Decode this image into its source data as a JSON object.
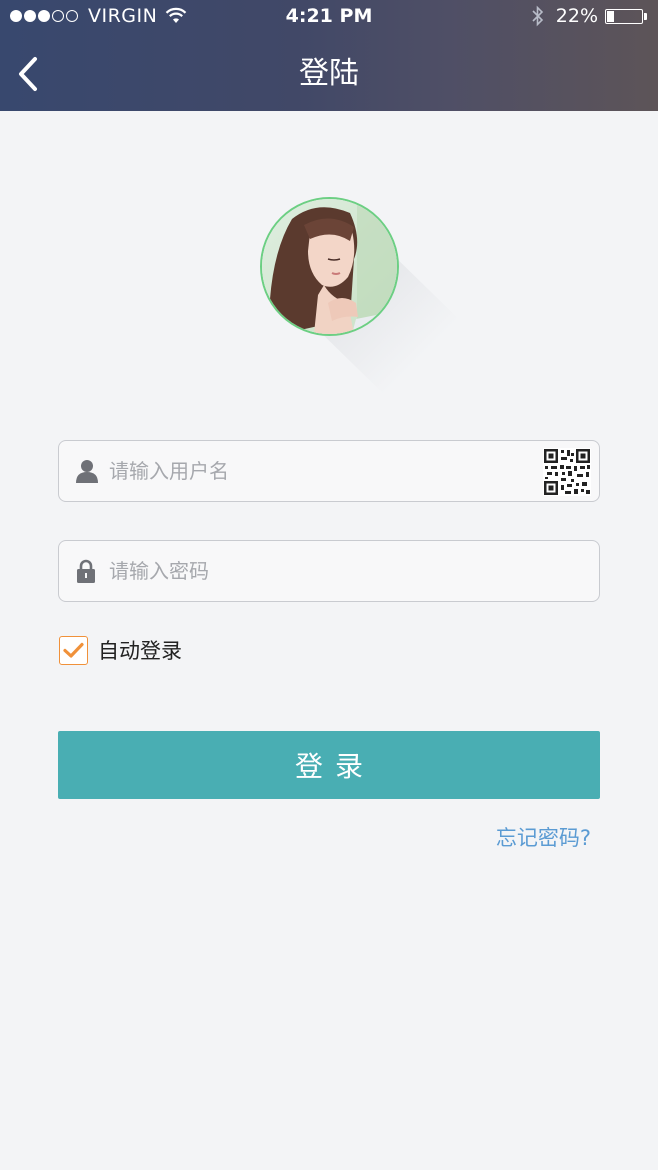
{
  "status_bar": {
    "carrier": "VIRGIN",
    "time": "4:21 PM",
    "battery_percent": "22%",
    "battery_level": 0.22,
    "signal_bars_filled": 3,
    "signal_bars_total": 5
  },
  "nav": {
    "title": "登陆",
    "back_icon": "chevron-left-icon"
  },
  "avatar": {
    "ring_color": "#6ccf83"
  },
  "username_field": {
    "placeholder": "请输入用户名",
    "value": "",
    "icon": "user-icon",
    "trailing_icon": "qr-code-icon"
  },
  "password_field": {
    "placeholder": "请输入密码",
    "value": "",
    "icon": "lock-icon"
  },
  "auto_login": {
    "label": "自动登录",
    "checked": true,
    "check_color": "#f0913a"
  },
  "login_button": {
    "label": "登录",
    "color": "#49aeb3"
  },
  "forgot_password": {
    "label": "忘记密码?",
    "color": "#5b9bd3"
  },
  "colors": {
    "header_start": "#38486e",
    "header_end": "#5d5458",
    "background": "#f3f4f6"
  }
}
